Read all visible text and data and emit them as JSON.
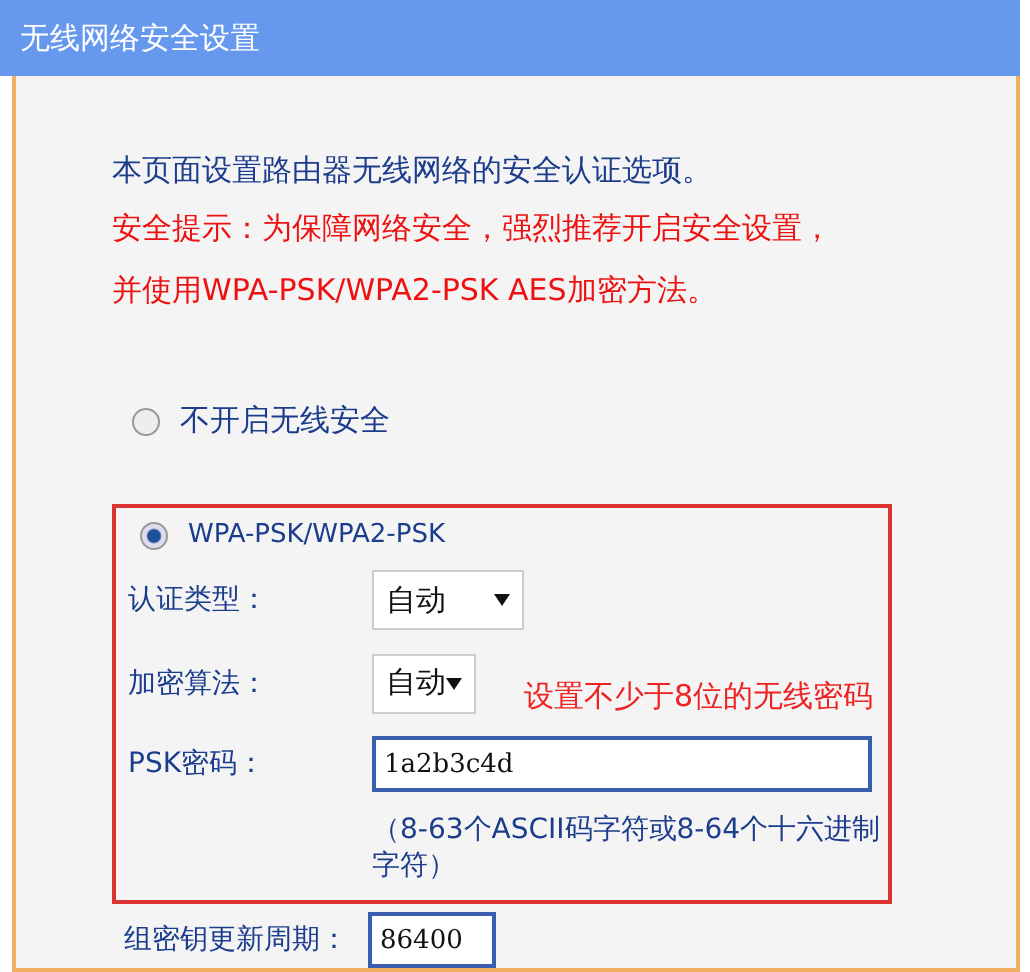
{
  "window": {
    "title": "无线网络安全设置"
  },
  "intro": "本页面设置路由器无线网络的安全认证选项。",
  "warning": "安全提示：为保障网络安全，强烈推荐开启安全设置，并使用WPA-PSK/WPA2-PSK AES加密方法。",
  "modes": [
    {
      "label": "不开启无线安全",
      "selected": false
    },
    {
      "label": "WPA-PSK/WPA2-PSK",
      "selected": true
    }
  ],
  "auth_type": {
    "label": "认证类型：",
    "value": "自动"
  },
  "encryption": {
    "label": "加密算法：",
    "value": "自动",
    "annotation": "设置不少于8位的无线密码"
  },
  "psk": {
    "label": "PSK密码：",
    "value": "1a2b3c4d",
    "hint": "（8-63个ASCII码字符或8-64个十六进制字符）"
  },
  "group_key": {
    "label": "组密钥更新周期：",
    "value": "86400"
  }
}
